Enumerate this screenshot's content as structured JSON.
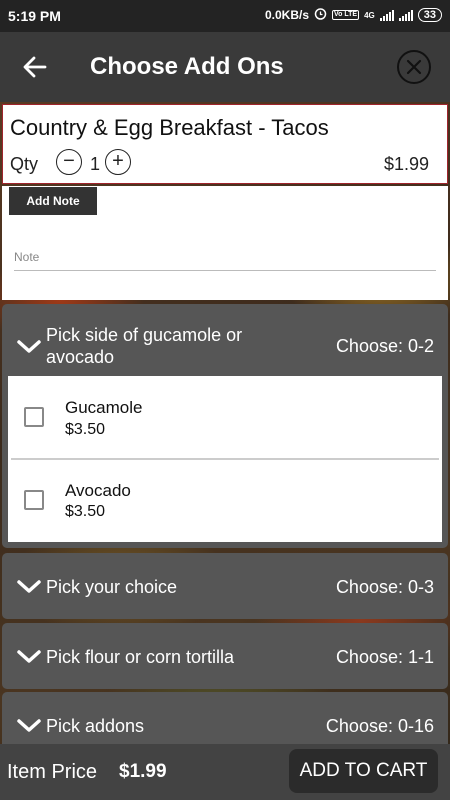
{
  "status": {
    "time": "5:19 PM",
    "network_speed": "0.0KB/s",
    "alarm_icon": "alarm-icon",
    "volte": "Vo LTE",
    "network_type": "4G",
    "battery": "33"
  },
  "header": {
    "title": "Choose Add Ons",
    "back_icon": "arrow-left-icon",
    "close_icon": "close-circle-icon"
  },
  "item": {
    "name": "Country & Egg Breakfast - Tacos",
    "qty_label": "Qty",
    "qty_minus": "−",
    "qty_value": "1",
    "qty_plus": "+",
    "price": "$1.99"
  },
  "note": {
    "add_note_label": "Add Note",
    "placeholder": "Note"
  },
  "sections": [
    {
      "title": "Pick side of gucamole or avocado",
      "choose": "Choose: 0-2",
      "options": [
        {
          "name": "Gucamole",
          "price": "$3.50"
        },
        {
          "name": "Avocado",
          "price": "$3.50"
        }
      ]
    },
    {
      "title": "Pick your choice",
      "choose": "Choose: 0-3"
    },
    {
      "title": "Pick flour or corn tortilla",
      "choose": "Choose: 1-1"
    },
    {
      "title": "Pick addons",
      "choose": "Choose: 0-16"
    }
  ],
  "footer": {
    "item_price_label": "Item Price",
    "item_price_value": "$1.99",
    "add_to_cart_label": "ADD TO CART"
  },
  "colors": {
    "header_bg": "#3a3a3a",
    "section_bg": "#565656",
    "item_border": "#a0242c",
    "button_dark": "#2b2b2b"
  }
}
